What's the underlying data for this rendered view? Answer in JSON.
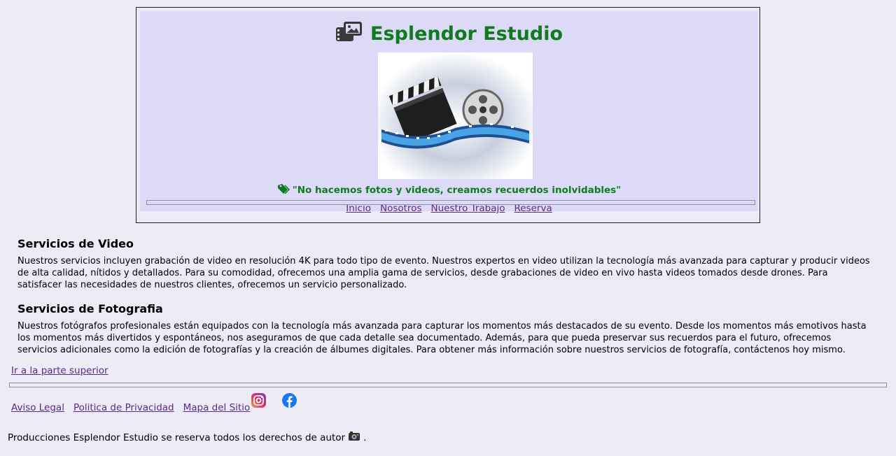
{
  "header": {
    "title": "Esplendor Estudio",
    "slogan": "\"No hacemos fotos y videos, creamos recuerdos inolvidables\"",
    "nav": [
      "Inicio",
      "Nosotros",
      "Nuestro Trabajo",
      "Reserva"
    ]
  },
  "sections": [
    {
      "heading": "Servicios de Video",
      "body": "Nuestros servicios incluyen grabación de video en resolución 4K para todo tipo de evento. Nuestros expertos en video utilizan la tecnología más avanzada para capturar y producir videos de alta calidad, nítidos y detallados. Para su comodidad, ofrecemos una amplia gama de servicios, desde grabaciones de video en vivo hasta videos tomados desde drones. Para satisfacer las necesidades de nuestros clientes, ofrecemos un servicio personalizado."
    },
    {
      "heading": "Servicios de Fotografia",
      "body": "Nuestros fotógrafos profesionales están equipados con la tecnología más avanzada para capturar los momentos más destacados de su evento. Desde los momentos más emotivos hasta los momentos más divertidos y espontáneos, nos aseguramos de que cada detalle sea documentado. Además, para que pueda preservar sus recuerdos para el futuro, ofrecemos servicios adicionales como la edición de fotografías y la creación de álbumes digitales. Para obtener más información sobre nuestros servicios de fotografía, contáctenos hoy mismo."
    }
  ],
  "top_link": "Ir a la parte superior",
  "footer": {
    "links": [
      "Aviso Legal",
      "Politica de Privacidad",
      "Mapa del Sitio"
    ],
    "copyright": "Producciones Esplendor Estudio se reserva todos los derechos de autor",
    "copyright_end": "."
  },
  "icons": {
    "title_icon": "photo-video-icon",
    "slogan_icon": "tags-icon",
    "instagram": "instagram-icon",
    "facebook": "facebook-icon",
    "camera": "camera-icon"
  },
  "colors": {
    "background": "#ecebf6",
    "header_panel": "#dcdaf6",
    "title_green": "#107a1e",
    "link_purple": "#5b2a86"
  }
}
